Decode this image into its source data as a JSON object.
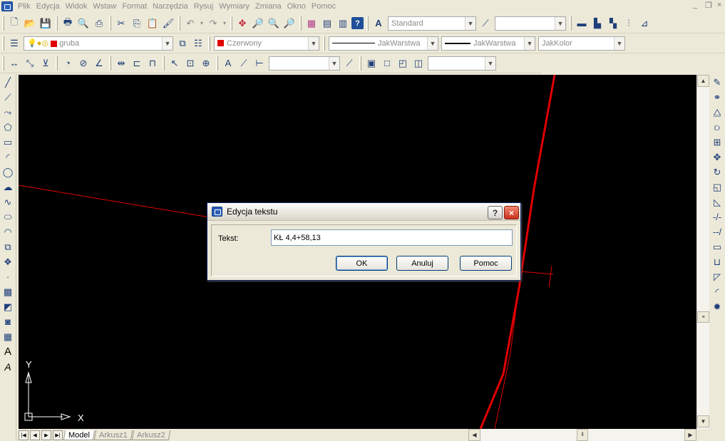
{
  "menu": {
    "items": [
      "Plik",
      "Edycja",
      "Widok",
      "Wstaw",
      "Format",
      "Narzędzia",
      "Rysuj",
      "Wymiary",
      "Zmiana",
      "Okno",
      "Pomoc"
    ],
    "window_controls": [
      "_",
      "❐",
      "×"
    ]
  },
  "toolbar1": {
    "style_combo": "Standard",
    "dimstyle_combo": ""
  },
  "toolbar2": {
    "layer_combo": "gruba",
    "color_combo": "Czerwony",
    "color_swatch": "#e00000",
    "linetype_combo": "JakWarstwa",
    "lineweight_combo": "JakWarstwa",
    "plotstyle_combo": "JakKolor"
  },
  "toolbar3": {
    "dim_combo": "",
    "view_combo": ""
  },
  "canvas": {
    "background": "#000000",
    "line_color": "#e00000",
    "ucs_x_label": "X",
    "ucs_y_label": "Y"
  },
  "tabs": [
    "Model",
    "Arkusz1",
    "Arkusz2"
  ],
  "dialog": {
    "title": "Edycja tekstu",
    "help_button": "?",
    "close_button": "×",
    "label": "Tekst:",
    "value": "KŁ 4,4+58,13",
    "ok_label": "OK",
    "cancel_label": "Anuluj",
    "help_label": "Pomoc"
  }
}
